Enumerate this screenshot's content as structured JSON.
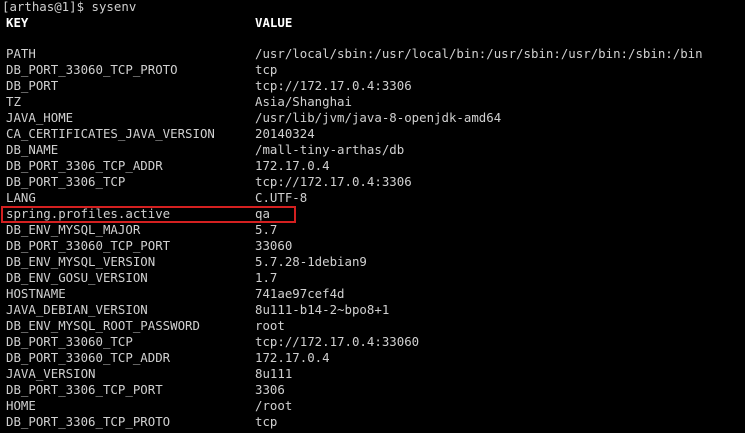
{
  "terminal": {
    "prompt": "[arthas@1]$ sysenv",
    "header": {
      "key": "KEY",
      "value": "VALUE"
    },
    "rows": [
      {
        "key": "PATH",
        "value": "/usr/local/sbin:/usr/local/bin:/usr/sbin:/usr/bin:/sbin:/bin"
      },
      {
        "key": "DB_PORT_33060_TCP_PROTO",
        "value": "tcp"
      },
      {
        "key": "DB_PORT",
        "value": "tcp://172.17.0.4:3306"
      },
      {
        "key": "TZ",
        "value": "Asia/Shanghai"
      },
      {
        "key": "JAVA_HOME",
        "value": "/usr/lib/jvm/java-8-openjdk-amd64"
      },
      {
        "key": "CA_CERTIFICATES_JAVA_VERSION",
        "value": "20140324"
      },
      {
        "key": "DB_NAME",
        "value": "/mall-tiny-arthas/db"
      },
      {
        "key": "DB_PORT_3306_TCP_ADDR",
        "value": "172.17.0.4"
      },
      {
        "key": "DB_PORT_3306_TCP",
        "value": "tcp://172.17.0.4:3306"
      },
      {
        "key": "LANG",
        "value": "C.UTF-8"
      },
      {
        "key": "spring.profiles.active",
        "value": "qa"
      },
      {
        "key": "DB_ENV_MYSQL_MAJOR",
        "value": "5.7"
      },
      {
        "key": "DB_PORT_33060_TCP_PORT",
        "value": "33060"
      },
      {
        "key": "DB_ENV_MYSQL_VERSION",
        "value": "5.7.28-1debian9"
      },
      {
        "key": "DB_ENV_GOSU_VERSION",
        "value": "1.7"
      },
      {
        "key": "HOSTNAME",
        "value": "741ae97cef4d"
      },
      {
        "key": "JAVA_DEBIAN_VERSION",
        "value": "8u111-b14-2~bpo8+1"
      },
      {
        "key": "DB_ENV_MYSQL_ROOT_PASSWORD",
        "value": "root"
      },
      {
        "key": "DB_PORT_33060_TCP",
        "value": "tcp://172.17.0.4:33060"
      },
      {
        "key": "DB_PORT_33060_TCP_ADDR",
        "value": "172.17.0.4"
      },
      {
        "key": "JAVA_VERSION",
        "value": "8u111"
      },
      {
        "key": "DB_PORT_3306_TCP_PORT",
        "value": "3306"
      },
      {
        "key": "HOME",
        "value": "/root"
      },
      {
        "key": "DB_PORT_3306_TCP_PROTO",
        "value": "tcp"
      }
    ]
  },
  "colors": {
    "background": "#000000",
    "text": "#d0d0d0",
    "header": "#ffffff",
    "highlight_border": "#d42020"
  }
}
